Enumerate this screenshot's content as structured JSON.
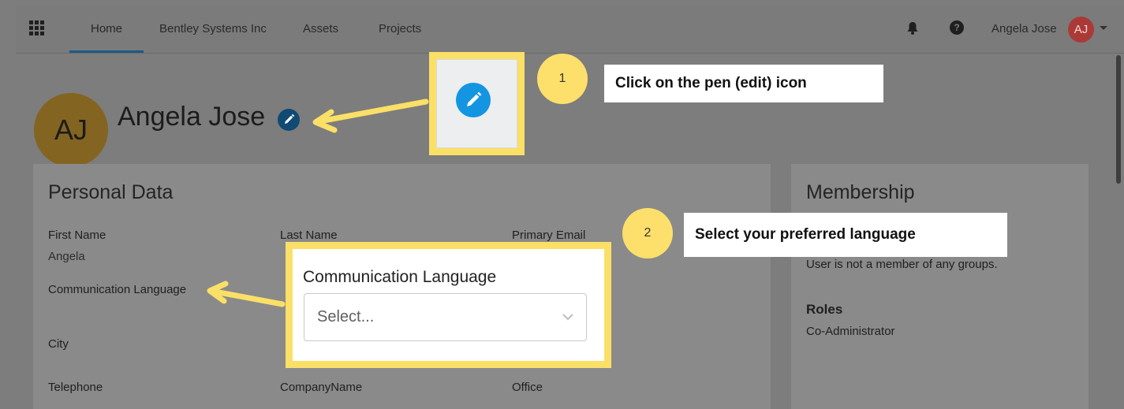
{
  "nav": {
    "tabs": [
      "Home",
      "Bentley Systems Inc",
      "Assets",
      "Projects"
    ],
    "active_tab": "Home",
    "user_name": "Angela Jose",
    "user_initials": "AJ",
    "help_glyph": "?"
  },
  "profile": {
    "initials": "AJ",
    "name": "Angela Jose"
  },
  "personal_data": {
    "title": "Personal Data",
    "first_name_label": "First Name",
    "first_name_value": "Angela",
    "last_name_label": "Last Name",
    "primary_email_label": "Primary Email",
    "communication_language_label": "Communication Language",
    "city_label": "City",
    "telephone_label": "Telephone",
    "company_name_label": "CompanyName",
    "office_label": "Office"
  },
  "membership": {
    "title": "Membership",
    "groups_text": "User is not a member of any groups.",
    "roles_heading": "Roles",
    "roles_value": "Co-Administrator"
  },
  "callouts": {
    "step1_number": "1",
    "step1_text": "Click on the pen (edit) icon",
    "step2_number": "2",
    "step2_text": "Select your preferred language"
  },
  "language_popup": {
    "label": "Communication Language",
    "placeholder": "Select..."
  },
  "colors": {
    "overlay_gray": "#7d7d7d",
    "highlight_yellow": "#fbe067",
    "edit_blue": "#1495e2",
    "avatar_gold": "#846421",
    "avatar_red": "#aa3a37"
  },
  "icons": [
    "apps-grid-icon",
    "bell-icon",
    "help-icon",
    "chevron-down-icon",
    "pencil-icon"
  ]
}
